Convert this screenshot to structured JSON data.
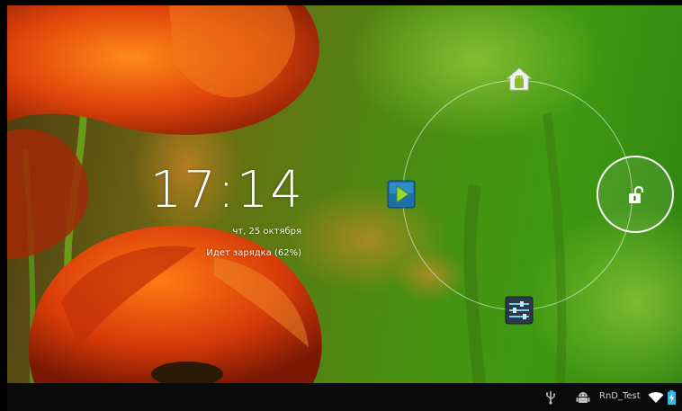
{
  "lockscreen": {
    "time": "17:14",
    "date": "чт, 25 октября",
    "charging": "Идет зарядка (62%)"
  },
  "targets": {
    "home": "home-android-icon",
    "media": "media-player-icon",
    "settings": "settings-sliders-icon",
    "unlock": "unlock-padlock-icon"
  },
  "status_bar": {
    "network_name": "RnD_Test",
    "icons": [
      "usb-icon",
      "android-debug-icon",
      "wifi-icon",
      "battery-charging-icon"
    ]
  },
  "colors": {
    "status_bar_bg": "#0a0a0a",
    "wifi_color": "#ffffff",
    "battery_color": "#33b5e5"
  }
}
